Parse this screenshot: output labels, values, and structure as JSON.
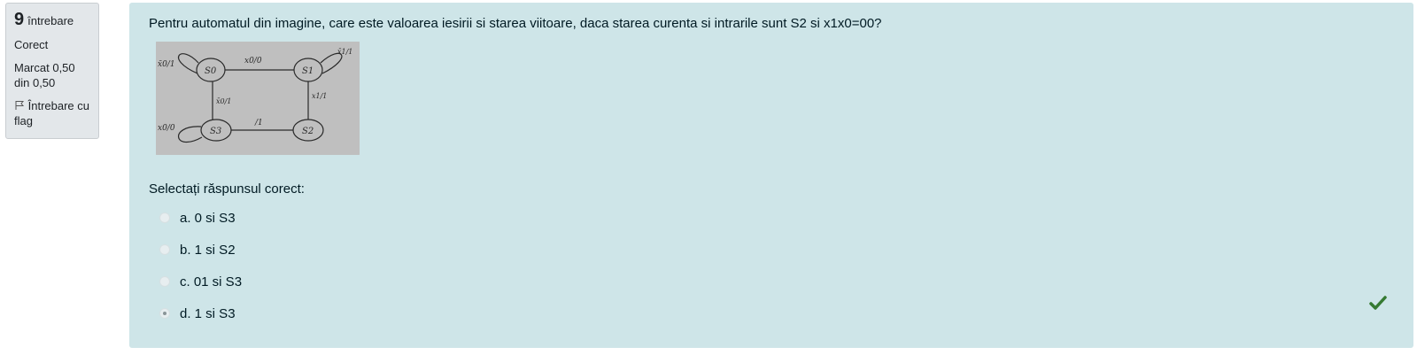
{
  "info": {
    "number": "9",
    "question_word": "întrebare",
    "status": "Corect",
    "mark_line1": "Marcat 0,50",
    "mark_line2": "din 0,50",
    "flag_label": "Întrebare cu flag"
  },
  "question": {
    "text": "Pentru automatul din imagine, care este valoarea iesirii si starea viitoare, daca starea curenta si intrarile sunt S2 si x1x0=00?",
    "diagram": {
      "states": [
        "S0",
        "S1",
        "S2",
        "S3"
      ],
      "labels": [
        "x̄0/1",
        "x0/0",
        "x̄1/1",
        "x̄0/1",
        "x1/1",
        "x0/0",
        "/1"
      ]
    },
    "prompt": "Selectați răspunsul corect:",
    "answers": [
      {
        "label": "a. 0 si S3",
        "selected": false
      },
      {
        "label": "b. 1 si S2",
        "selected": false
      },
      {
        "label": "c. 01 si S3",
        "selected": false
      },
      {
        "label": "d. 1 si S3",
        "selected": true
      }
    ],
    "result": "correct",
    "colors": {
      "panel": "#cee5e8",
      "check": "#357a32"
    }
  }
}
